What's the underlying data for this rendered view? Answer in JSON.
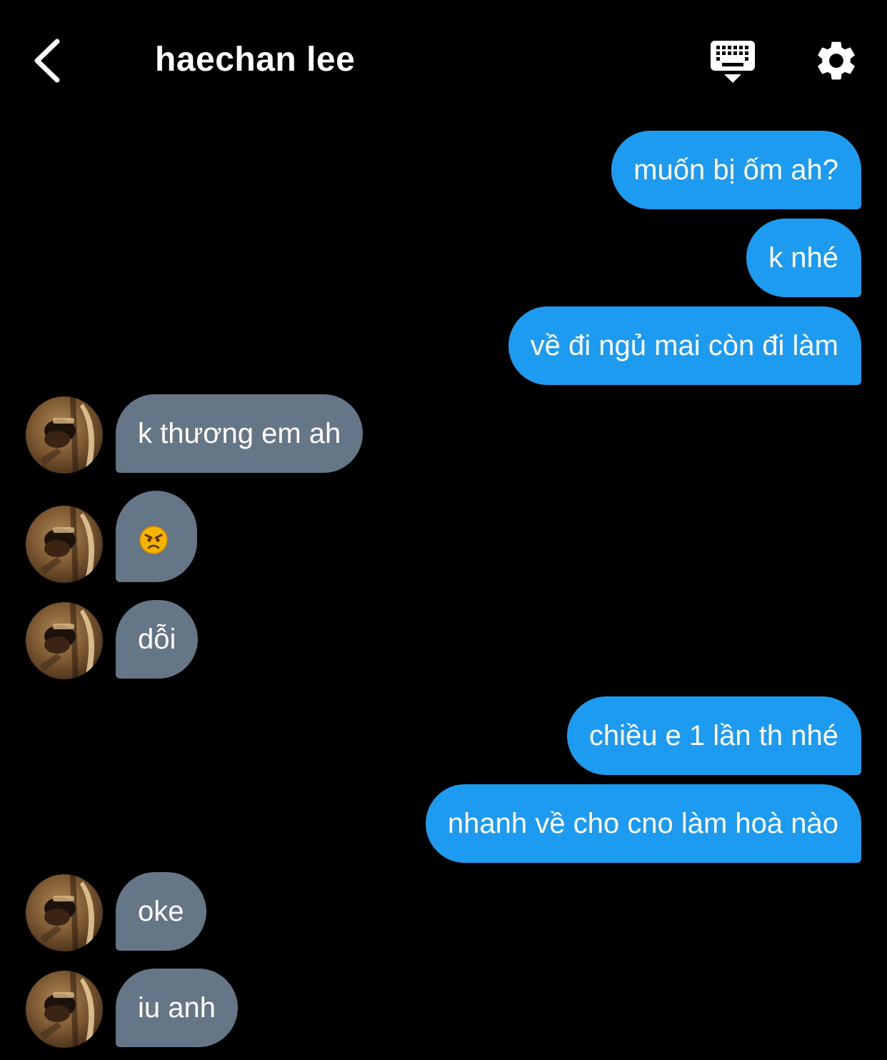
{
  "header": {
    "title": "haechan lee",
    "back_icon": "chevron-left-icon",
    "keyboard_icon": "keyboard-hide-icon",
    "settings_icon": "gear-icon"
  },
  "colors": {
    "background": "#000000",
    "outgoing_bubble": "#1d9bf0",
    "incoming_bubble": "#657786",
    "text": "#ffffff"
  },
  "messages": [
    {
      "direction": "out",
      "text": "muốn bị ốm ah?"
    },
    {
      "direction": "out",
      "text": "k nhé"
    },
    {
      "direction": "out",
      "text": "về đi ngủ mai còn đi làm"
    },
    {
      "direction": "in",
      "text": "k thương em ah"
    },
    {
      "direction": "in",
      "emoji": "angry-face-emoji"
    },
    {
      "direction": "in",
      "text": "dỗi"
    },
    {
      "direction": "out",
      "text": "chiều e 1 lần th nhé"
    },
    {
      "direction": "out",
      "text": "nhanh về cho cno làm hoà nào"
    },
    {
      "direction": "in",
      "text": "oke"
    },
    {
      "direction": "in",
      "text": "iu anh"
    }
  ]
}
